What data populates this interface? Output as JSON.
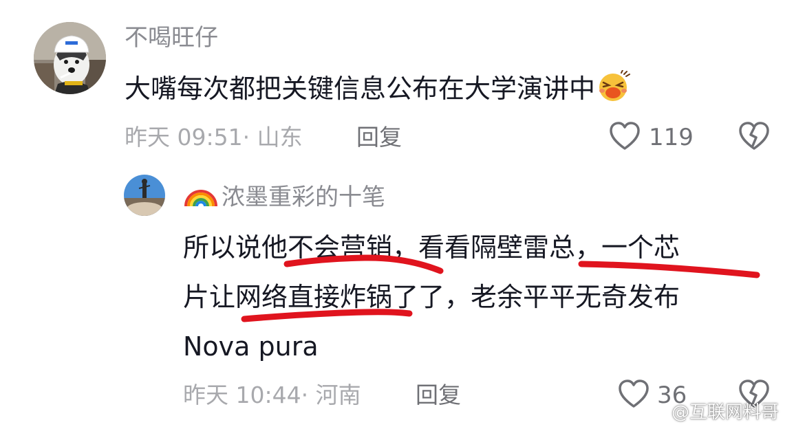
{
  "comment": {
    "username": "不喝旺仔",
    "text": "大嘴每次都把关键信息公布在大学演讲中",
    "emoji": "😆",
    "time_location": "昨天 09:51· 山东",
    "reply_label": "回复",
    "like_count": "119"
  },
  "reply": {
    "username_prefix_emoji": "🌈",
    "username": "浓墨重彩的十笔",
    "text_line1": "所以说他不会营销，看看隔壁雷总，一个芯",
    "text_line2": "片让网络直接炸锅了了，老余平平无奇发布",
    "text_line3": "Nova pura",
    "time_location": "昨天 10:44· 河南",
    "reply_label": "回复",
    "like_count": "36"
  },
  "watermark": {
    "prefix": "微博",
    "text": "@互联网料哥"
  },
  "colors": {
    "username": "#8a8b91",
    "text": "#161823",
    "meta": "#a8a9ad",
    "annotation_red": "#e0141e"
  },
  "icons": [
    "heart-outline-icon",
    "broken-heart-icon",
    "weibo-logo-icon"
  ]
}
